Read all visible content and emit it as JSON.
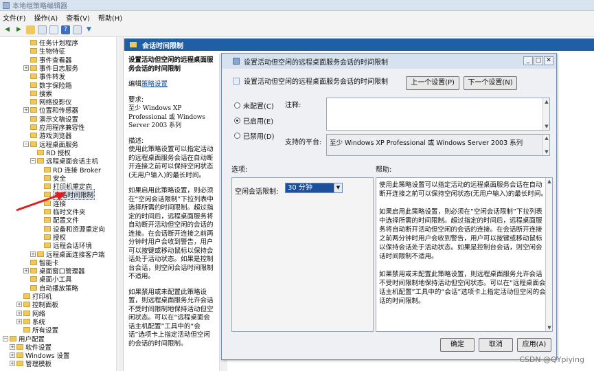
{
  "window": {
    "title": "本地组策略编辑器"
  },
  "menu": [
    "文件(F)",
    "操作(A)",
    "查看(V)",
    "帮助(H)"
  ],
  "tree": [
    {
      "label": "任务计划程序",
      "indent": 3,
      "exp": false
    },
    {
      "label": "生物特征",
      "indent": 3,
      "exp": false
    },
    {
      "label": "事件查看器",
      "indent": 3,
      "exp": false
    },
    {
      "label": "事件日志服务",
      "indent": 3,
      "exp": true
    },
    {
      "label": "事件转发",
      "indent": 3,
      "exp": false
    },
    {
      "label": "数字保险箱",
      "indent": 3,
      "exp": false
    },
    {
      "label": "搜索",
      "indent": 3,
      "exp": false
    },
    {
      "label": "网络投影仪",
      "indent": 3,
      "exp": false
    },
    {
      "label": "位置和传感器",
      "indent": 3,
      "exp": true
    },
    {
      "label": "演示文稿设置",
      "indent": 3,
      "exp": false
    },
    {
      "label": "应用程序兼容性",
      "indent": 3,
      "exp": false
    },
    {
      "label": "游戏浏览器",
      "indent": 3,
      "exp": false
    },
    {
      "label": "远程桌面服务",
      "indent": 3,
      "exp": true,
      "open": true
    },
    {
      "label": "RD 授权",
      "indent": 4,
      "exp": false
    },
    {
      "label": "远程桌面会话主机",
      "indent": 4,
      "exp": true,
      "open": true
    },
    {
      "label": "RD 连接 Broker",
      "indent": 5,
      "exp": false
    },
    {
      "label": "安全",
      "indent": 5,
      "exp": false
    },
    {
      "label": "打印机重定向",
      "indent": 5,
      "exp": false
    },
    {
      "label": "会话时间限制",
      "indent": 5,
      "exp": false,
      "selected": true
    },
    {
      "label": "连接",
      "indent": 5,
      "exp": false
    },
    {
      "label": "临时文件夹",
      "indent": 5,
      "exp": false
    },
    {
      "label": "配置文件",
      "indent": 5,
      "exp": false
    },
    {
      "label": "设备和资源重定向",
      "indent": 5,
      "exp": false
    },
    {
      "label": "授权",
      "indent": 5,
      "exp": false
    },
    {
      "label": "远程会话环境",
      "indent": 5,
      "exp": false
    },
    {
      "label": "远程桌面连接客户端",
      "indent": 4,
      "exp": true
    },
    {
      "label": "智能卡",
      "indent": 3,
      "exp": false
    },
    {
      "label": "桌面窗口管理器",
      "indent": 3,
      "exp": true
    },
    {
      "label": "桌面小工具",
      "indent": 3,
      "exp": false
    },
    {
      "label": "自动播放策略",
      "indent": 3,
      "exp": false
    },
    {
      "label": "打印机",
      "indent": 2,
      "exp": false
    },
    {
      "label": "控制面板",
      "indent": 2,
      "exp": true
    },
    {
      "label": "网络",
      "indent": 2,
      "exp": true
    },
    {
      "label": "系统",
      "indent": 2,
      "exp": true
    },
    {
      "label": "所有设置",
      "indent": 2,
      "exp": false
    },
    {
      "label": "用户配置",
      "indent": 0,
      "exp": true,
      "open": true
    },
    {
      "label": "软件设置",
      "indent": 1,
      "exp": true
    },
    {
      "label": "Windows 设置",
      "indent": 1,
      "exp": true
    },
    {
      "label": "管理模板",
      "indent": 1,
      "exp": true
    }
  ],
  "midpane": {
    "header": "会话时间限制",
    "policy_title": "设置活动但空闲的远程桌面服务会话的时间限制",
    "edit_prefix": "编辑",
    "edit_link": "策略设置",
    "req_label": "要求:",
    "req_text": "至少 Windows XP Professional 或 Windows Server 2003 系列",
    "desc_label": "描述:",
    "desc_p1": "使用此策略设置可以指定活动的远程桌面服务会话在自动断开连接之前可以保持空闲状态(无用户输入)的最长时间。",
    "desc_p2": "如果启用此策略设置，则必须在“空闲会话限制”下拉列表中选择所需的时间限制。超过指定的时间后，远程桌面服务将自动断开活动但空闲的会话的连接。在会话断开连接之前两分钟时用户会收到警告，用户可以按键或移动鼠标以保持会话处于活动状态。如果是控制台会话，则空闲会话时间限制不适用。",
    "desc_p3": "如果禁用或未配置此策略设置，则远程桌面服务允许会话不受时间限制地保持活动但空闲状态。可以在“远程桌面会话主机配置”工具中的“会话”选项卡上指定活动但空闲的会话的时间限制。"
  },
  "dialog": {
    "title": "设置活动但空闲的远程桌面服务会话的时间限制",
    "subtitle": "设置活动但空闲的远程桌面服务会话的时间限制",
    "prev_button": "上一个设置(P)",
    "next_button": "下一个设置(N)",
    "radio_not_configured": "未配置(C)",
    "radio_enabled": "已启用(E)",
    "radio_disabled": "已禁用(D)",
    "selected_radio": "enabled",
    "comment_label": "注释:",
    "supported_label": "支持的平台:",
    "supported_value": "至少 Windows XP Professional 或 Windows Server 2003 系列",
    "options_label": "选项:",
    "help_label": "帮助:",
    "idle_limit_label": "空闲会话限制:",
    "idle_limit_value": "30 分钟",
    "help_p1": "使用此策略设置可以指定活动的远程桌面服务会话在自动断开连接之前可以保持空闲状态(无用户输入)的最长时间。",
    "help_p2": "如果启用此策略设置，则必须在“空闲会话限制”下拉列表中选择所需的时间限制。超过指定的时间后，远程桌面服务将自动断开活动但空闲的会话的连接。在会话断开连接之前两分钟时用户会收到警告，用户可以按键或移动鼠标以保持会话处于活动状态。如果是控制台会话，则空闲会话时间限制不适用。",
    "help_p3": "如果禁用或未配置此策略设置，则远程桌面服务允许会话不受时间限制地保持活动但空闲状态。可以在“远程桌面会话主机配置”工具中的“会话”选项卡上指定活动但空闲的会话的时间限制。",
    "ok_button": "确定",
    "cancel_button": "取消",
    "apply_button": "应用(A)"
  },
  "watermark": "CSDN @QYpiying",
  "colors": {
    "header_blue": "#1f5fa6",
    "arrow_red": "#e02020"
  }
}
